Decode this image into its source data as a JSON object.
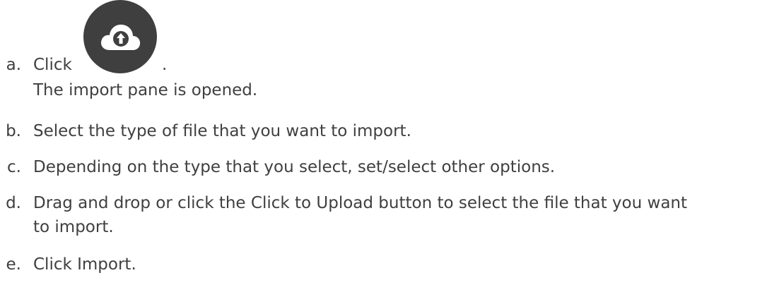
{
  "steps": [
    {
      "marker": "a.",
      "text": "Click",
      "suffix": ".",
      "note": "The import pane is opened."
    },
    {
      "marker": "b.",
      "text": "Select the type of file that you want to import."
    },
    {
      "marker": "c.",
      "text": "Depending on the type that you select, set/select other options."
    },
    {
      "marker": "d.",
      "text": "Drag and drop or click the Click to Upload button to select the file that you want",
      "continuation": "to import."
    },
    {
      "marker": "e.",
      "text": "Click Import."
    }
  ],
  "icons": {
    "upload": "cloud-upload-icon"
  },
  "colors": {
    "text": "#3f3f3f",
    "button_bg": "#3f3f3f",
    "icon": "#ffffff"
  }
}
